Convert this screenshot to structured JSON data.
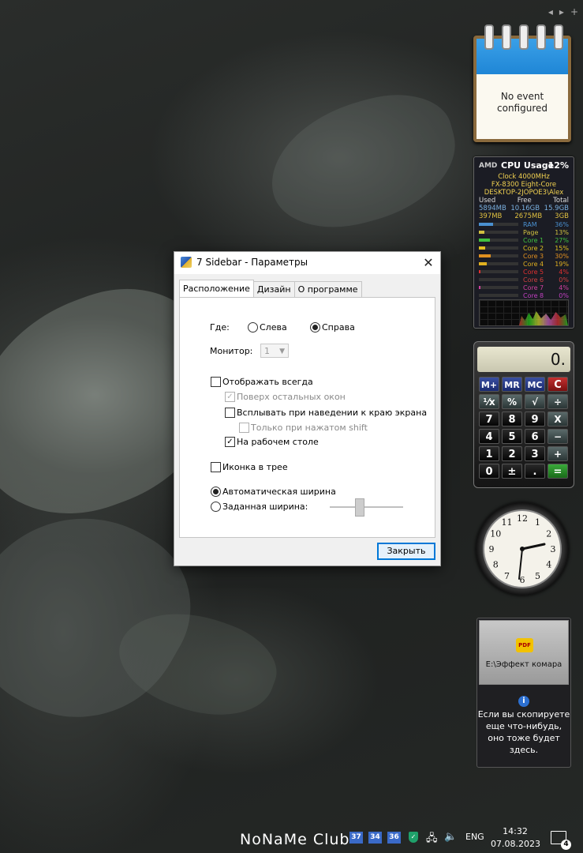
{
  "sidebar_controls": {
    "prev": "◂",
    "next": "▸",
    "add": "+"
  },
  "notes": {
    "text": "No event\nconfigured"
  },
  "cpu": {
    "logo": "AMD",
    "title": "CPU Usage",
    "usage": "12%",
    "clock": "Clock 4000MHz",
    "model": "FX-8300 Eight-Core",
    "host": "DESKTOP-2JOPOE3\\Alex",
    "mem_headers": [
      "Used",
      "Free",
      "Total"
    ],
    "mem_row1": [
      "5894MB",
      "10.16GB",
      "15.9GB"
    ],
    "mem_row2": [
      "397MB",
      "2675MB",
      "3GB"
    ],
    "rows": [
      {
        "label": "RAM",
        "value": "36%",
        "color": "#4a90d0",
        "level": 0.36
      },
      {
        "label": "Page",
        "value": "13%",
        "color": "#d0c040",
        "level": 0.13
      },
      {
        "label": "Core 1",
        "value": "27%",
        "color": "#40c040",
        "level": 0.27
      },
      {
        "label": "Core 2",
        "value": "15%",
        "color": "#e0c020",
        "level": 0.15
      },
      {
        "label": "Core 3",
        "value": "30%",
        "color": "#e09020",
        "level": 0.3
      },
      {
        "label": "Core 4",
        "value": "19%",
        "color": "#e0b020",
        "level": 0.19
      },
      {
        "label": "Core 5",
        "value": "4%",
        "color": "#e03030",
        "level": 0.04
      },
      {
        "label": "Core 6",
        "value": "0%",
        "color": "#d04040",
        "level": 0.0
      },
      {
        "label": "Core 7",
        "value": "4%",
        "color": "#d040a0",
        "level": 0.04
      },
      {
        "label": "Core 8",
        "value": "0%",
        "color": "#c040c0",
        "level": 0.0
      }
    ]
  },
  "calculator": {
    "display": "0.",
    "keys": [
      "M+",
      "MR",
      "MC",
      "C",
      "⅟x",
      "%",
      "√",
      "÷",
      "7",
      "8",
      "9",
      "X",
      "4",
      "5",
      "6",
      "−",
      "1",
      "2",
      "3",
      "+",
      "0",
      "±",
      ".",
      "="
    ]
  },
  "clock": {
    "numbers": [
      "12",
      "1",
      "2",
      "3",
      "4",
      "5",
      "6",
      "7",
      "8",
      "9",
      "10",
      "11"
    ],
    "time_shown": "14:32"
  },
  "drop": {
    "file_badge": "PDF",
    "file_name": "E:\\Эффект комара",
    "info_icon": "i",
    "message": "Если вы скопируете\nеще что-нибудь,\nоно тоже будет\nздесь."
  },
  "dialog": {
    "title": "7 Sidebar - Параметры",
    "close": "✕",
    "tabs": [
      "Расположение",
      "Дизайн",
      "О программе"
    ],
    "where_label": "Где:",
    "left_option": "Слева",
    "right_option": "Справа",
    "monitor_label": "Монитор:",
    "monitor_value": "1",
    "always_show": "Отображать всегда",
    "on_top": "Поверх остальных окон",
    "popup_edge": "Всплывать при наведении к краю экрана",
    "only_shift": "Только при нажатом shift",
    "on_desktop": "На рабочем столе",
    "tray_icon": "Иконка в трее",
    "auto_width": "Автоматическая ширина",
    "set_width": "Заданная ширина:",
    "close_button": "Закрыть"
  },
  "taskbar": {
    "brand": "NoNaMe Club",
    "badges": [
      "37",
      "34",
      "36"
    ],
    "language": "ENG",
    "time": "14:32",
    "date": "07.08.2023",
    "notifications": "4"
  }
}
